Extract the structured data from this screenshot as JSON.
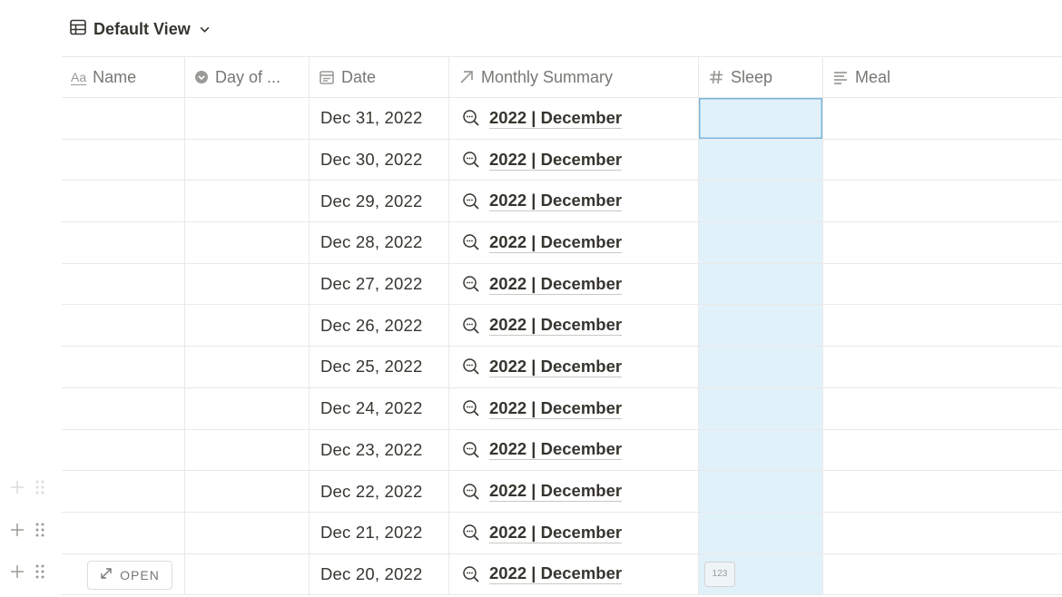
{
  "view": {
    "title": "Default View"
  },
  "columns": [
    {
      "key": "name",
      "label": "Name",
      "icon": "text-aa-icon"
    },
    {
      "key": "day",
      "label": "Day of ...",
      "icon": "select-dropdown-icon"
    },
    {
      "key": "date",
      "label": "Date",
      "icon": "calendar-icon"
    },
    {
      "key": "monthly",
      "label": "Monthly Summary",
      "icon": "relation-arrow-icon"
    },
    {
      "key": "sleep",
      "label": "Sleep",
      "icon": "hash-icon"
    },
    {
      "key": "meal",
      "label": "Meal",
      "icon": "text-lines-icon"
    }
  ],
  "name_icon_text": "Aa",
  "rows": [
    {
      "date": "Dec 31, 2022",
      "monthly": "2022 | December"
    },
    {
      "date": "Dec 30, 2022",
      "monthly": "2022 | December"
    },
    {
      "date": "Dec 29, 2022",
      "monthly": "2022 | December"
    },
    {
      "date": "Dec 28, 2022",
      "monthly": "2022 | December"
    },
    {
      "date": "Dec 27, 2022",
      "monthly": "2022 | December"
    },
    {
      "date": "Dec 26, 2022",
      "monthly": "2022 | December"
    },
    {
      "date": "Dec 25, 2022",
      "monthly": "2022 | December"
    },
    {
      "date": "Dec 24, 2022",
      "monthly": "2022 | December"
    },
    {
      "date": "Dec 23, 2022",
      "monthly": "2022 | December"
    },
    {
      "date": "Dec 22, 2022",
      "monthly": "2022 | December"
    },
    {
      "date": "Dec 21, 2022",
      "monthly": "2022 | December"
    },
    {
      "date": "Dec 20, 2022",
      "monthly": "2022 | December"
    }
  ],
  "hover_row": {
    "open_label": "OPEN",
    "number_badge": "123"
  },
  "colors": {
    "sleep_column_bg": "#e1f1fa",
    "selected_border": "#7ab8dc",
    "text": "#37352f",
    "muted": "#787774"
  }
}
